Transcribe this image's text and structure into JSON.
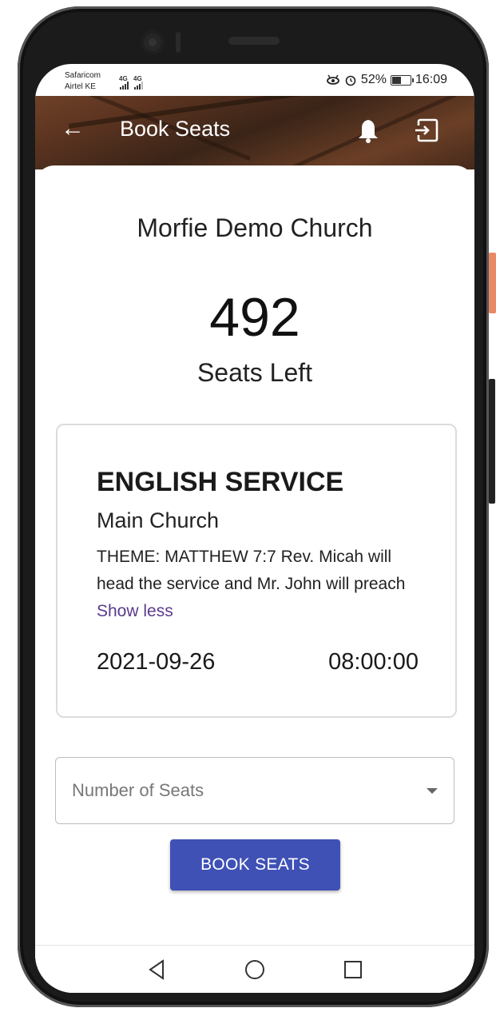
{
  "status_bar": {
    "carrier_1": "Safaricom",
    "carrier_2": "Airtel KE",
    "signal_1": "4G",
    "signal_2": "4G",
    "battery": "52%",
    "battery_level": 0.52,
    "time": "16:09",
    "status_icons": [
      "eye-comfort-icon",
      "alarm-icon"
    ]
  },
  "app_bar": {
    "title": "Book Seats",
    "back_icon": "arrow-left-icon",
    "notification_icon": "bell-icon",
    "logout_icon": "logout-icon"
  },
  "main": {
    "church_name": "Morfie Demo Church",
    "seats_left_count": "492",
    "seats_left_label": "Seats Left"
  },
  "service": {
    "title": "ENGLISH SERVICE",
    "location": "Main Church",
    "description": "THEME: MATTHEW 7:7 Rev. Micah will head the service and Mr. John will preach",
    "toggle_label": "Show less",
    "date": "2021-09-26",
    "time": "08:00:00"
  },
  "form": {
    "seats_label": "Number of Seats",
    "button_label": "BOOK SEATS"
  },
  "colors": {
    "accent": "#3f51b5",
    "link": "#5a3a8c"
  },
  "navigation": {
    "icons": [
      "nav-back-icon",
      "nav-home-icon",
      "nav-recent-icon"
    ]
  }
}
